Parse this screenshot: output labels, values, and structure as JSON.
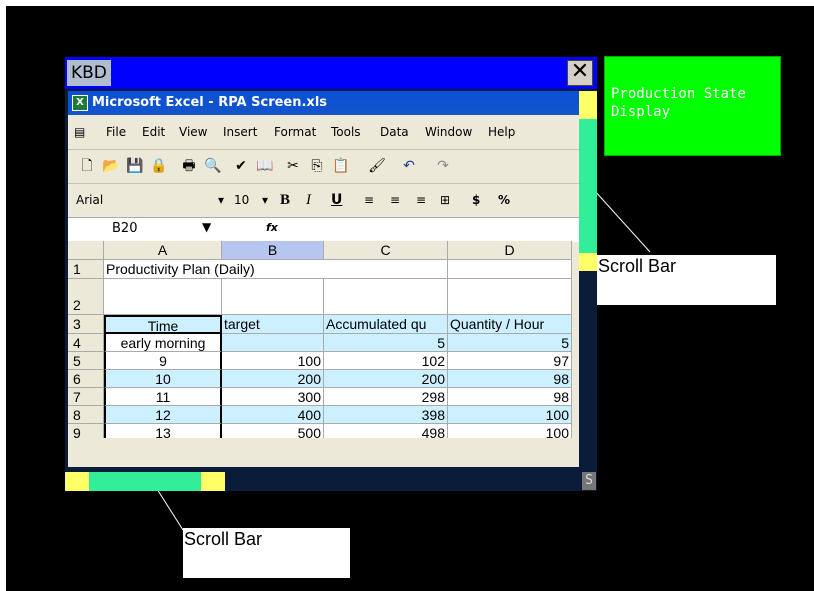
{
  "kbd_label": "KBD",
  "close_glyph": "✕",
  "excel": {
    "title": "Microsoft Excel - RPA Screen.xls",
    "menu": [
      "File",
      "Edit",
      "View",
      "Insert",
      "Format",
      "Tools",
      "Data",
      "Window",
      "Help"
    ],
    "font_name": "Arial",
    "font_size": "10",
    "bold_label": "B",
    "italic_label": "I",
    "underline_label": "U",
    "currency_label": "$",
    "percent_label": "%",
    "name_box": "B20",
    "fx_label": "fx"
  },
  "sheet": {
    "columns": [
      "A",
      "B",
      "C",
      "D"
    ],
    "row_numbers": [
      "1",
      "2",
      "3",
      "4",
      "5",
      "6",
      "7",
      "8",
      "9"
    ],
    "title_cell": "Productivity Plan (Daily)",
    "headers": [
      "Time",
      "target",
      "Accumulated qu",
      "Quantity / Hour"
    ],
    "rows": [
      [
        "early morning",
        "",
        "5",
        "5"
      ],
      [
        "9",
        "100",
        "102",
        "97"
      ],
      [
        "10",
        "200",
        "200",
        "98"
      ],
      [
        "11",
        "300",
        "298",
        "98"
      ],
      [
        "12",
        "400",
        "398",
        "100"
      ],
      [
        "13",
        "500",
        "498",
        "100"
      ]
    ]
  },
  "scroll_s_label": "S",
  "production_panel": "Production State Display",
  "callouts": {
    "right": "Scroll Bar",
    "bottom": "Scroll Bar"
  },
  "colors": {
    "kbd_bar": "#0000ff",
    "scroll_yellow": "#ffff66",
    "scroll_thumb": "#33ee99",
    "panel_green": "#00ff00",
    "highlight_cells": "#ccf0ff"
  }
}
